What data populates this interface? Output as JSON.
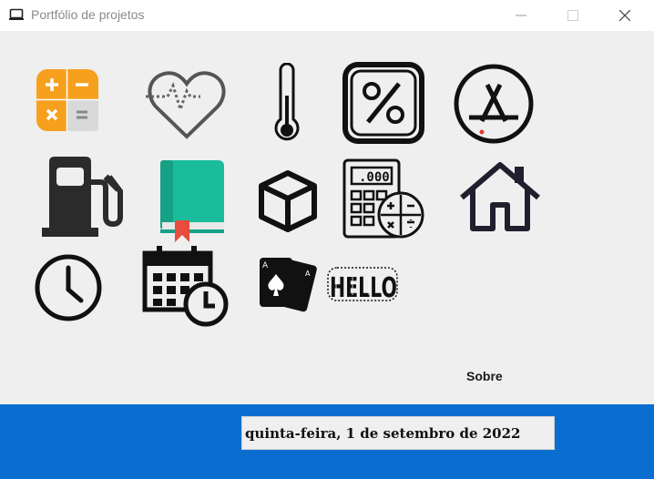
{
  "window": {
    "title": "Portfólio de projetos",
    "controls": [
      "minimize-icon",
      "maximize-icon",
      "close-icon"
    ]
  },
  "apps": [
    {
      "icon": "calculator-icon"
    },
    {
      "icon": "heart-pulse-icon"
    },
    {
      "icon": "thermometer-icon"
    },
    {
      "icon": "percent-icon"
    },
    {
      "icon": "app-store-icon"
    },
    {
      "icon": "fuel-pump-icon"
    },
    {
      "icon": "book-icon"
    },
    {
      "icon": "cube-icon"
    },
    {
      "icon": "calculator-keypad-icon"
    },
    {
      "icon": "home-icon"
    },
    {
      "icon": "clock-icon"
    },
    {
      "icon": "calendar-clock-icon"
    },
    {
      "icon": "playing-cards-icon"
    },
    {
      "icon": "hello-icon"
    }
  ],
  "about_label": "Sobre",
  "date_text": "quinta-feira, 1 de setembro de 2022",
  "colors": {
    "footer": "#0a6ed1",
    "background": "#efefef",
    "calculator_orange": "#f7a01e",
    "book_teal": "#1abc9c",
    "bookmark_red": "#e74c3c"
  }
}
